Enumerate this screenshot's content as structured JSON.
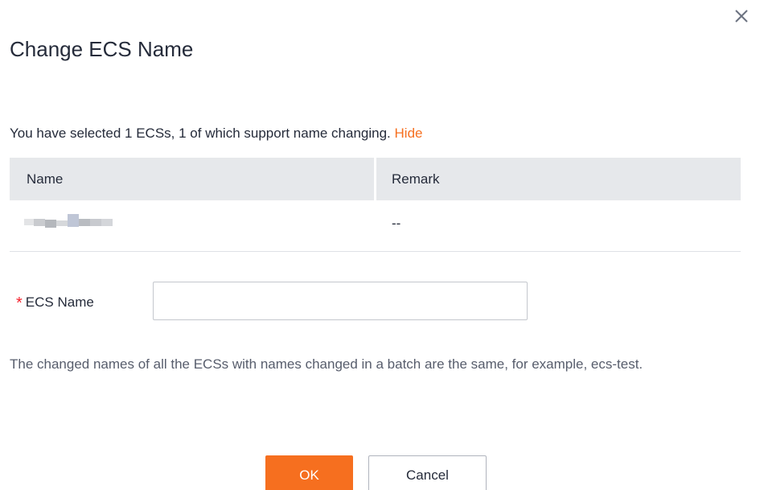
{
  "dialog": {
    "title": "Change ECS Name",
    "close_icon": "close-icon"
  },
  "summary": {
    "text": "You have selected 1 ECSs, 1 of which support name changing.",
    "hide_link": "Hide"
  },
  "table": {
    "columns": [
      "Name",
      "Remark"
    ],
    "rows": [
      {
        "name": "",
        "remark": "--"
      }
    ]
  },
  "form": {
    "ecs_name_label": "ECS Name",
    "required_marker": "*",
    "ecs_name_value": "",
    "ecs_name_placeholder": ""
  },
  "help_text": "The changed names of all the ECSs with names changed in a batch are the same, for example, ecs-test.",
  "buttons": {
    "ok": "OK",
    "cancel": "Cancel"
  },
  "colors": {
    "accent": "#f66f1f",
    "required": "#f5222d",
    "table_header_bg": "#e6e8eb"
  }
}
